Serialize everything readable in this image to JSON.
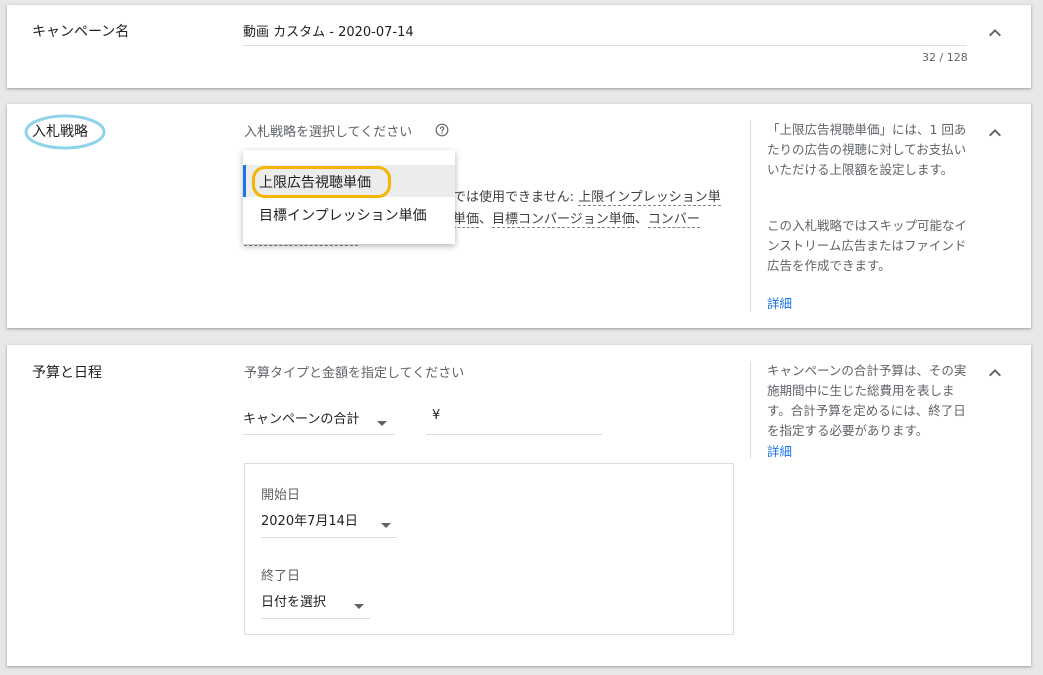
{
  "campaign_name": {
    "title": "キャンペーン名",
    "value": "動画 カスタム - 2020-07-14",
    "counter": "32 / 128"
  },
  "bidding": {
    "title": "入札戦略",
    "prompt": "入札戦略を選択してください",
    "notice_prefix": "では使用できません: ",
    "notice_line1_link": "上限インプレッション単",
    "notice_line2_link_a": "単価",
    "notice_line2_link_b": "目標コンバージョン単価",
    "notice_line2_link_c": "コンバー",
    "separator": "、",
    "dropdown": {
      "options": [
        "上限広告視聴単価",
        "目標インプレッション単価"
      ],
      "selected_index": 0
    },
    "help_text": "「上限広告視聴単価」には、1 回あたりの広告の視聴に対してお支払いいただける上限額を設定します。",
    "help_text2": "この入札戦略ではスキップ可能なインストリーム広告またはファインド広告を作成できます。",
    "help_link": "詳細"
  },
  "budget": {
    "title": "予算と日程",
    "prompt": "予算タイプと金額を指定してください",
    "budget_type": "キャンペーンの合計",
    "currency": "¥",
    "start_label": "開始日",
    "start_value": "2020年7月14日",
    "end_label": "終了日",
    "end_value": "日付を選択",
    "help_text": "キャンペーンの合計予算は、その実施期間中に生じた総費用を表します。合計予算を定めるには、終了日を指定する必要があります。",
    "help_link": "詳細"
  },
  "colors": {
    "highlight_circle": "#8fd3e8",
    "highlight_rect": "#f4b400",
    "accent": "#1a73e8"
  }
}
